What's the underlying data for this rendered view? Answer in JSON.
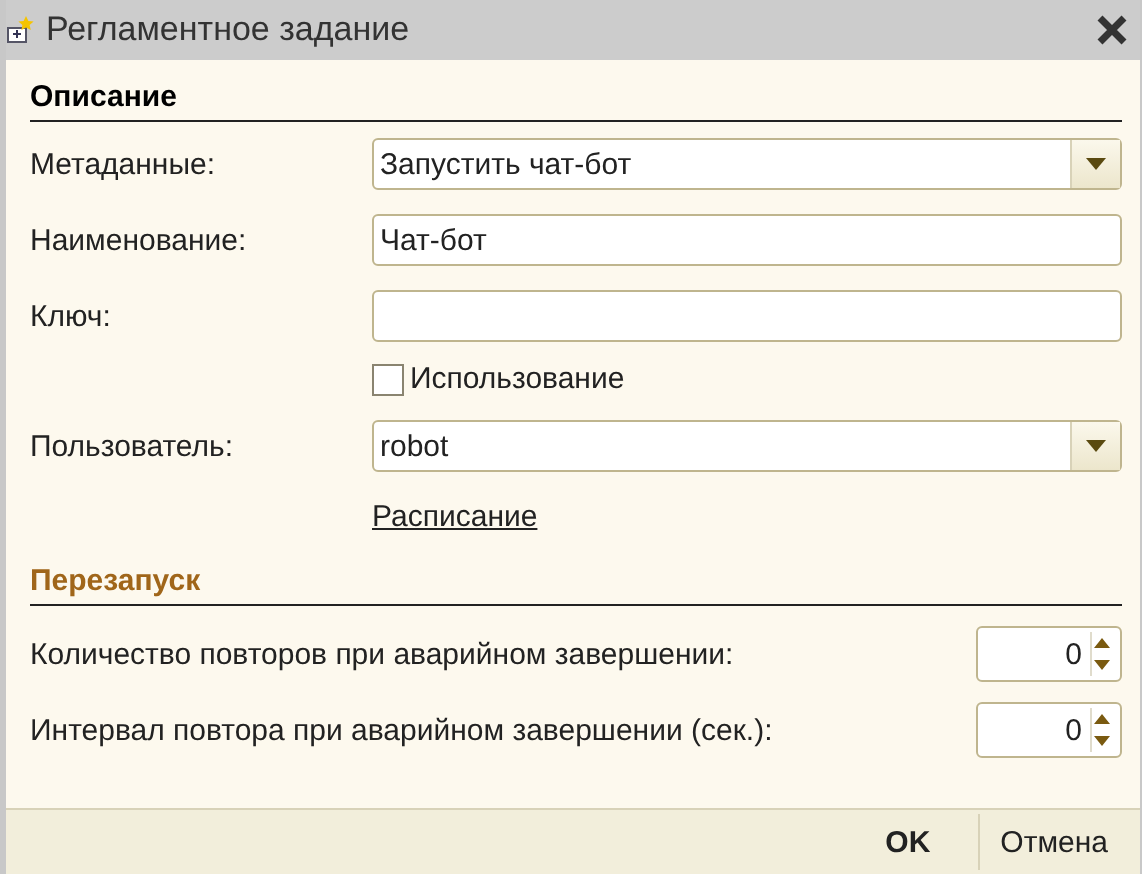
{
  "window": {
    "title": "Регламентное задание"
  },
  "description": {
    "title": "Описание",
    "color": "#000000",
    "rows": [
      {
        "kind": "select",
        "label": "Метаданные:",
        "value": "Запустить чат-бот"
      },
      {
        "kind": "text",
        "label": "Наименование:",
        "value": "Чат-бот"
      },
      {
        "kind": "text",
        "label": "Ключ:"
      },
      {
        "kind": "checkbox",
        "label": "Использование",
        "checked": false
      },
      {
        "kind": "select",
        "label": "Пользователь:",
        "value": "robot"
      },
      {
        "kind": "link",
        "label": "Расписание"
      }
    ]
  },
  "restart": {
    "title": "Перезапуск",
    "color": "#a0661a",
    "rows": [
      {
        "label": "Количество повторов при аварийном завершении:",
        "value": "0"
      },
      {
        "label": "Интервал повтора при аварийном завершении (сек.):",
        "value": "0"
      }
    ]
  },
  "buttons": [
    {
      "label": "OK",
      "default": true
    },
    {
      "label": "Отмена",
      "default": false
    }
  ]
}
